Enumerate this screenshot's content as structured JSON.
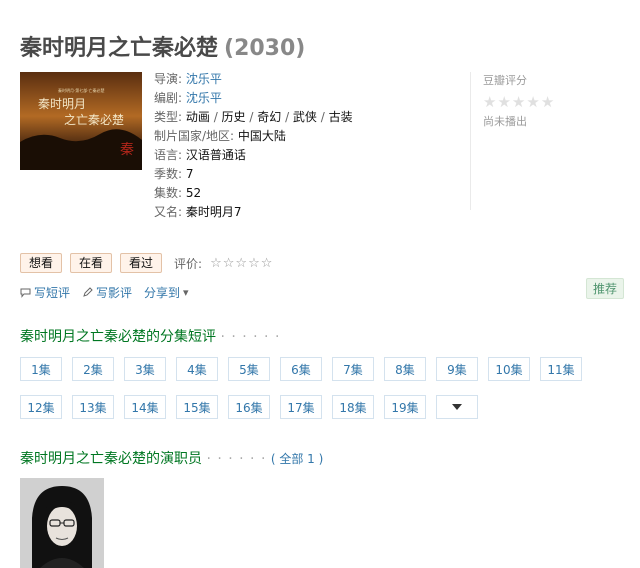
{
  "title": {
    "name": "秦时明月之亡秦必楚",
    "year": "(2030)"
  },
  "info": [
    {
      "key": "导演: ",
      "values": [
        "沈乐平"
      ],
      "link": true
    },
    {
      "key": "编剧: ",
      "values": [
        "沈乐平"
      ],
      "link": true
    },
    {
      "key": "类型: ",
      "values": [
        "动画",
        "历史",
        "奇幻",
        "武侠",
        "古装"
      ],
      "link": false
    },
    {
      "key": "制片国家/地区: ",
      "values": [
        "中国大陆"
      ],
      "link": false
    },
    {
      "key": "语言: ",
      "values": [
        "汉语普通话"
      ],
      "link": false
    },
    {
      "key": "季数: ",
      "values": [
        "7"
      ],
      "link": false
    },
    {
      "key": "集数: ",
      "values": [
        "52"
      ],
      "link": false
    },
    {
      "key": "又名: ",
      "values": [
        "秦时明月7"
      ],
      "link": false
    }
  ],
  "rating": {
    "label": "豆瓣评分",
    "status": "尚未播出"
  },
  "actions": {
    "want": "想看",
    "watching": "在看",
    "watched": "看过",
    "rate_label": "评价:"
  },
  "links": {
    "short_review": "写短评",
    "review": "写影评",
    "share": "分享到",
    "share_arrow": "▾"
  },
  "recommend": "推荐",
  "episodes_section": {
    "title": "秦时明月之亡秦必楚的分集短评",
    "dots": "· · · · · ·"
  },
  "episodes": [
    "1集",
    "2集",
    "3集",
    "4集",
    "5集",
    "6集",
    "7集",
    "8集",
    "9集",
    "10集",
    "11集",
    "12集",
    "13集",
    "14集",
    "15集",
    "16集",
    "17集",
    "18集",
    "19集"
  ],
  "cast_section": {
    "title": "秦时明月之亡秦必楚的演职员",
    "dots": "· · · · · ·",
    "all": "( 全部 1 )"
  },
  "poster": {
    "line1": "秦时明月",
    "line2": "之亡秦必楚",
    "small": "秦时明月·第七部·亡秦必楚",
    "seal": "秦"
  }
}
